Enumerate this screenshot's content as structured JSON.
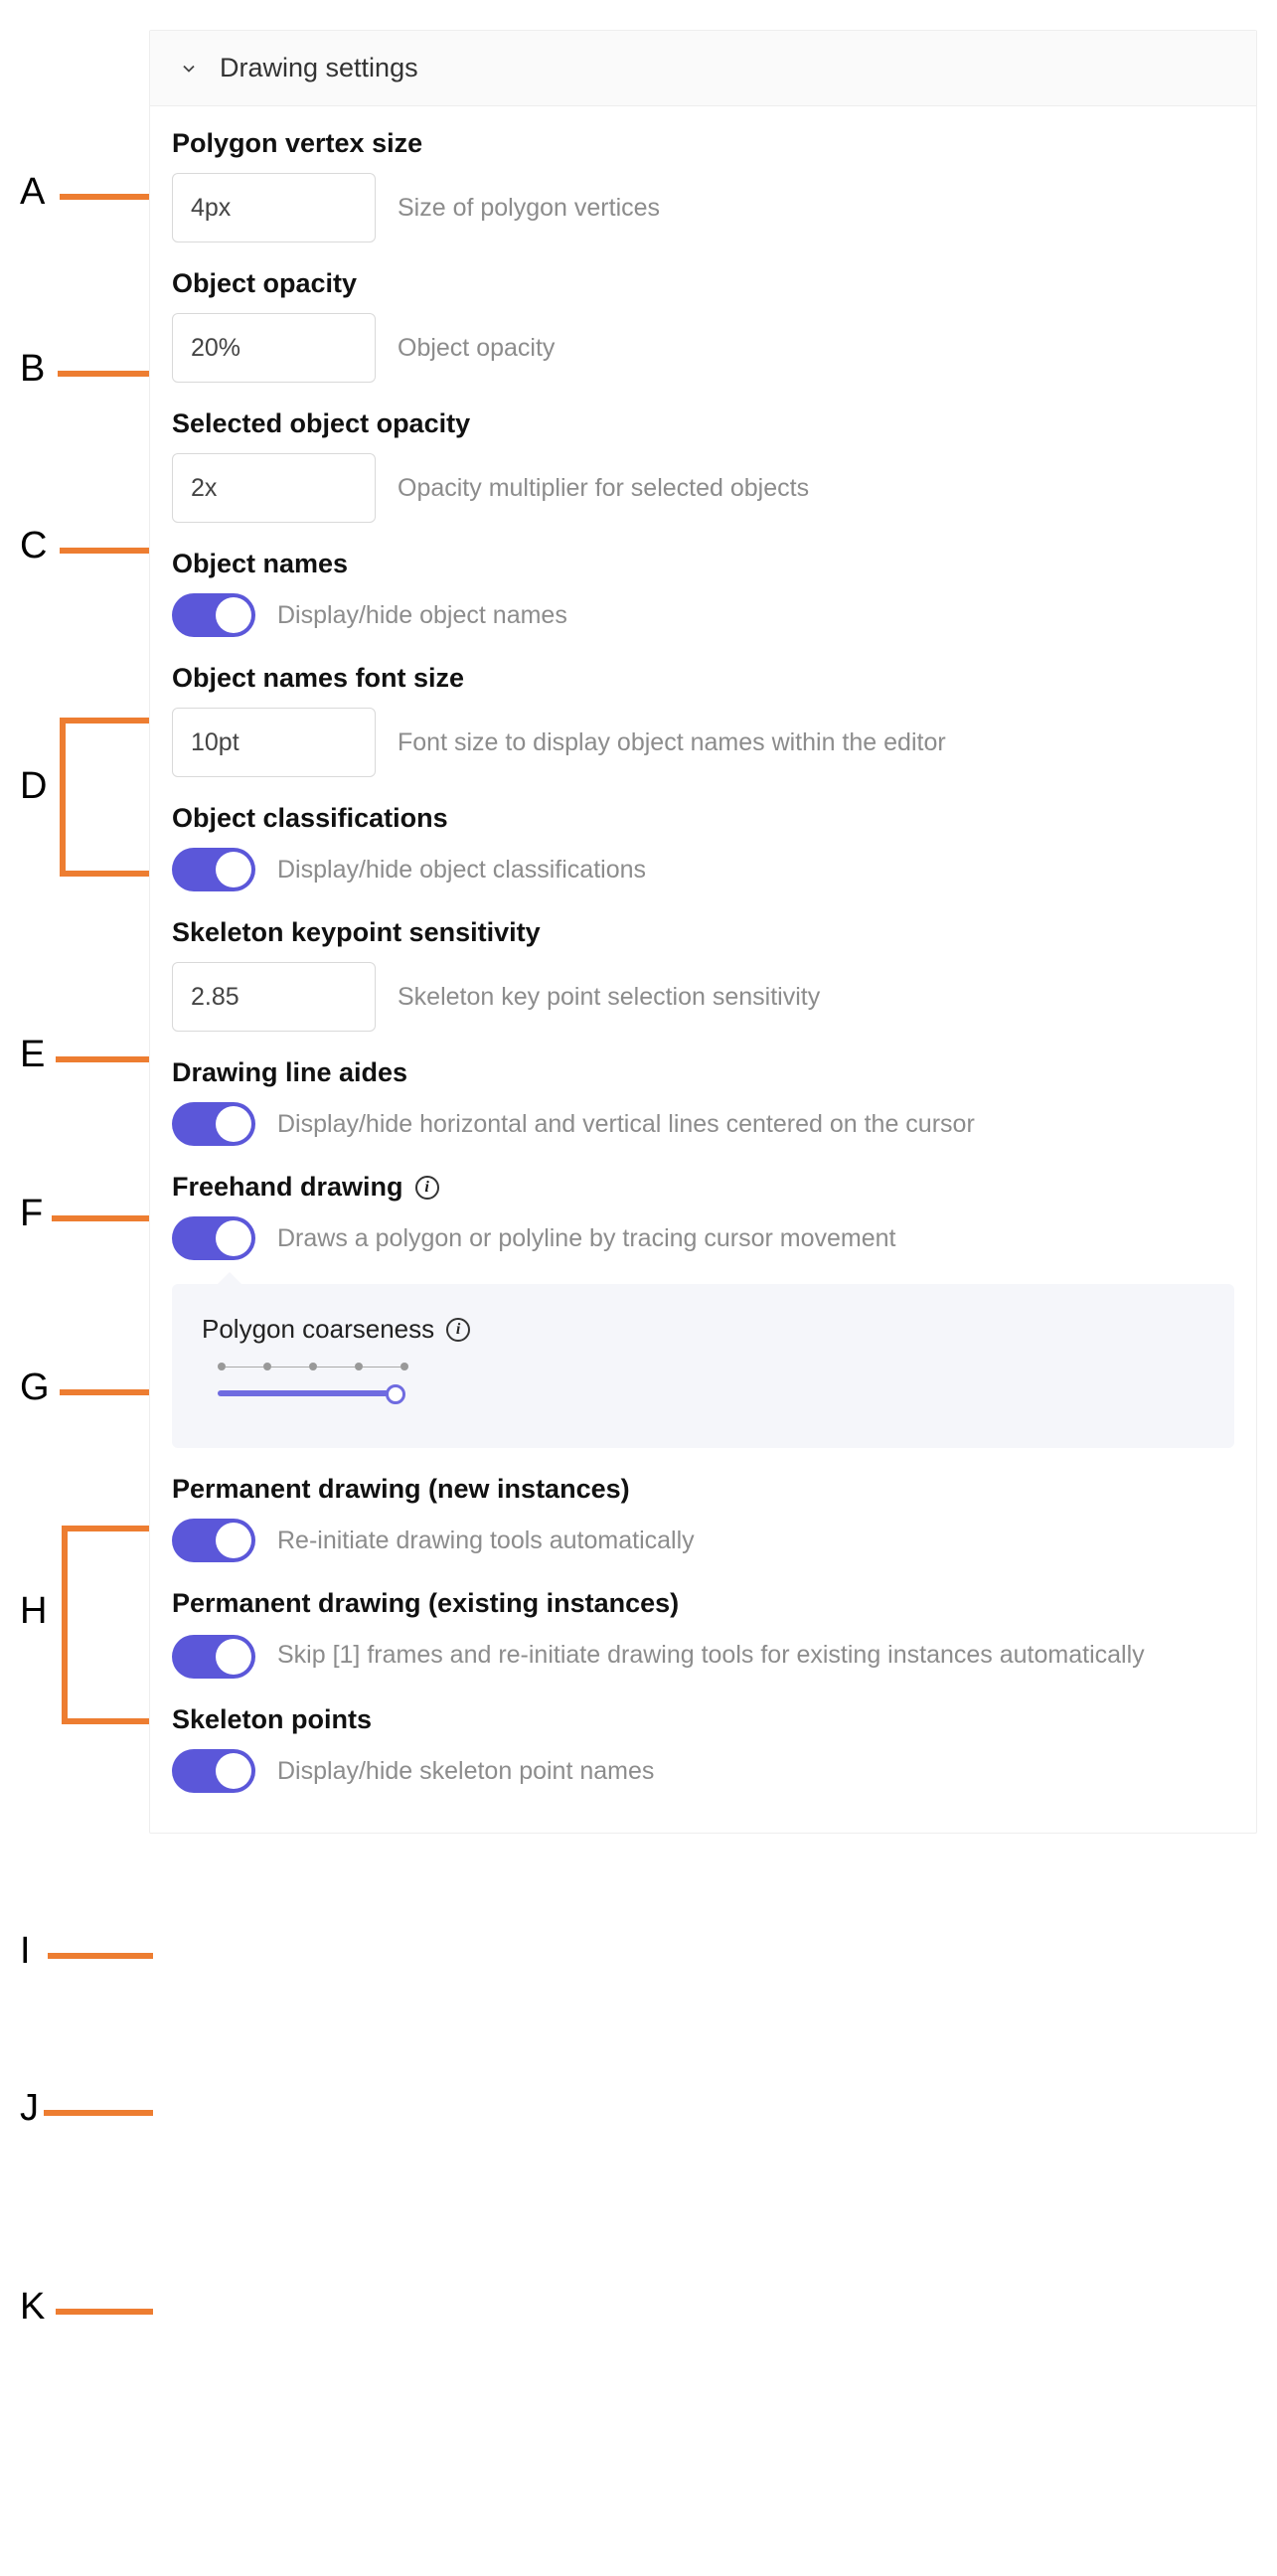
{
  "annotations": {
    "A": "A",
    "B": "B",
    "C": "C",
    "D": "D",
    "E": "E",
    "F": "F",
    "G": "G",
    "H": "H",
    "I": "I",
    "J": "J",
    "K": "K"
  },
  "header": {
    "title": "Drawing settings"
  },
  "settings": {
    "polygon_vertex_size": {
      "label": "Polygon vertex size",
      "value": "4px",
      "desc": "Size of polygon vertices"
    },
    "object_opacity": {
      "label": "Object opacity",
      "value": "20%",
      "desc": "Object opacity"
    },
    "selected_object_opacity": {
      "label": "Selected object opacity",
      "value": "2x",
      "desc": "Opacity multiplier for selected objects"
    },
    "object_names": {
      "label": "Object names",
      "desc": "Display/hide object names"
    },
    "object_names_font_size": {
      "label": "Object names font size",
      "value": "10pt",
      "desc": "Font size to display object names within the editor"
    },
    "object_classifications": {
      "label": "Object classifications",
      "desc": "Display/hide object classifications"
    },
    "skeleton_keypoint_sensitivity": {
      "label": "Skeleton keypoint sensitivity",
      "value": "2.85",
      "desc": "Skeleton key point selection sensitivity"
    },
    "drawing_line_aides": {
      "label": "Drawing line aides",
      "desc": "Display/hide horizontal and vertical lines centered on the cursor"
    },
    "freehand_drawing": {
      "label": "Freehand drawing",
      "desc": "Draws a polygon or polyline by tracing cursor movement"
    },
    "polygon_coarseness": {
      "label": "Polygon coarseness"
    },
    "permanent_drawing_new": {
      "label": "Permanent drawing (new instances)",
      "desc": "Re-initiate drawing tools automatically"
    },
    "permanent_drawing_existing": {
      "label": "Permanent drawing (existing instances)",
      "desc": "Skip [1] frames and re-initiate drawing tools for existing instances automatically"
    },
    "skeleton_points": {
      "label": "Skeleton points",
      "desc": "Display/hide skeleton point names"
    }
  }
}
